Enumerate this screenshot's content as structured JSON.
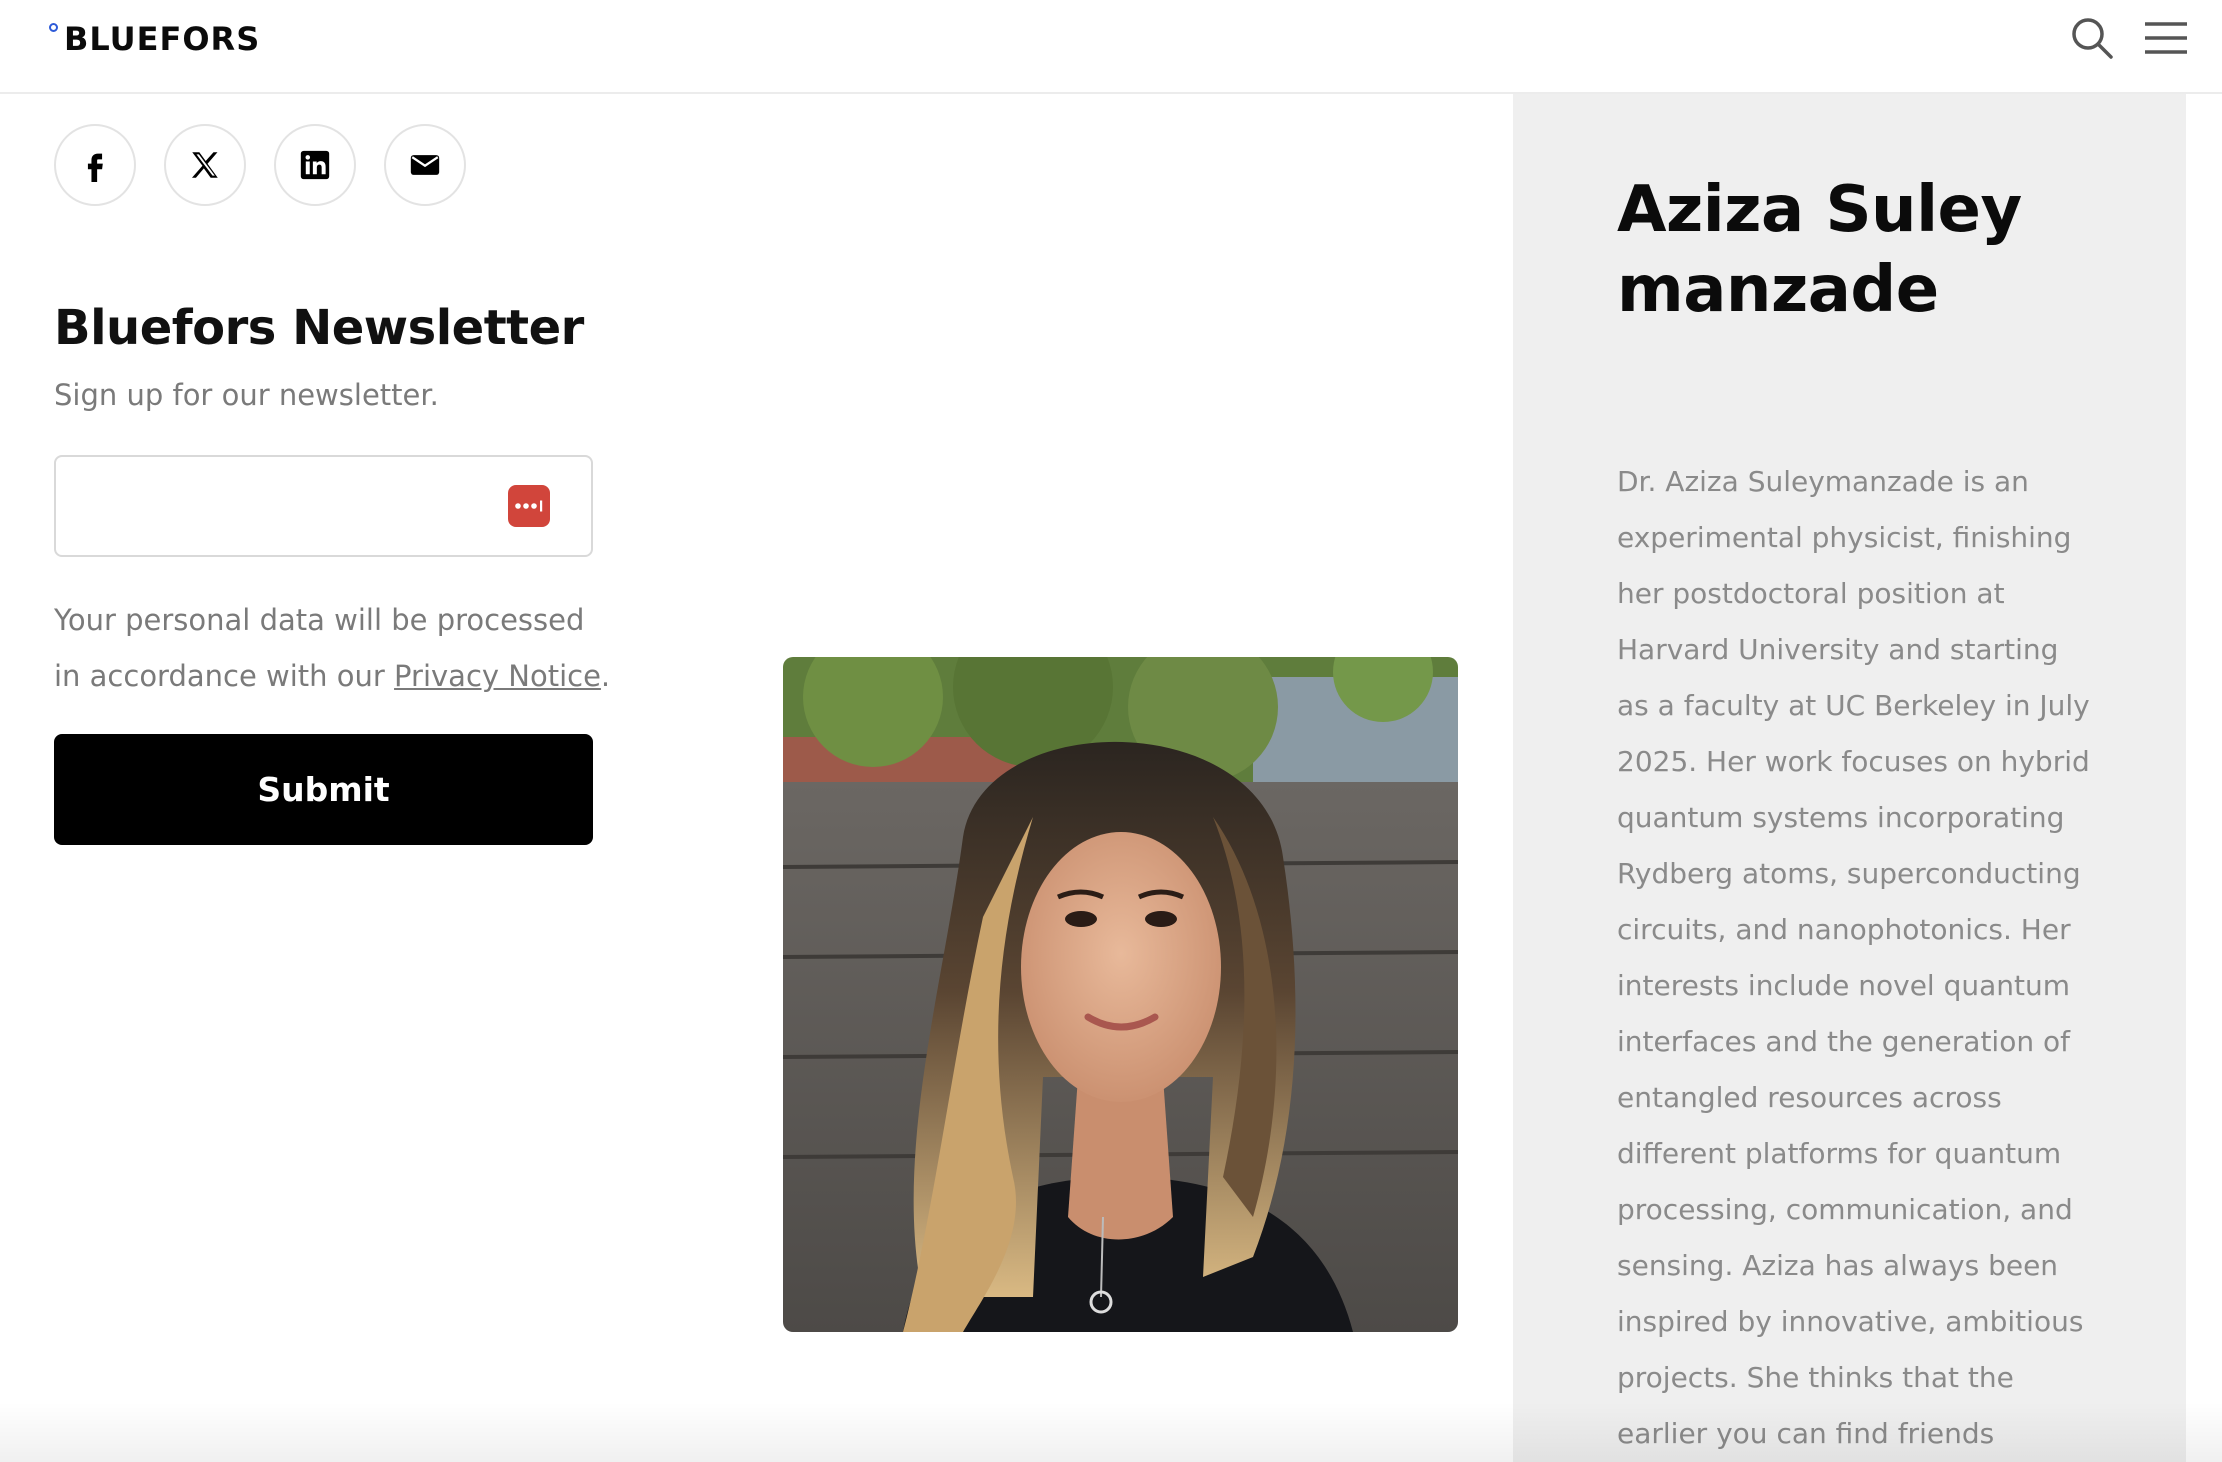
{
  "header": {
    "logo": "BLUEFORS"
  },
  "social": {
    "icons": [
      "facebook-icon",
      "x-icon",
      "linkedin-icon",
      "email-icon"
    ]
  },
  "newsletter": {
    "title": "Bluefors Newsletter",
    "subtitle": "Sign up for our newsletter.",
    "email_value": "",
    "consent_text": "Your personal data will be processed in accordance with our",
    "privacy_link": "Privacy Notice",
    "consent_end": ".",
    "submit_label": "Submit"
  },
  "profile": {
    "name": "Aziza Suleymanzade",
    "bio": "Dr. Aziza Suleymanzade is an experimental physicist, finishing her postdoctoral position at Harvard University and starting as a faculty at UC Berkeley in July 2025. Her work focuses on hybrid quantum systems incorporating Rydberg atoms, superconducting circuits, and nanophotonics. Her interests include novel quantum interfaces and the generation of entangled resources across different platforms for quantum processing, communication, and sensing.  Aziza has always been inspired by innovative, ambitious projects. She thinks that the earlier you can find friends"
  },
  "colors": {
    "accent_blue": "#2e5bd8",
    "password_manager_red": "#d1453b",
    "panel_bg": "#efefef",
    "button_bg": "#000000"
  }
}
